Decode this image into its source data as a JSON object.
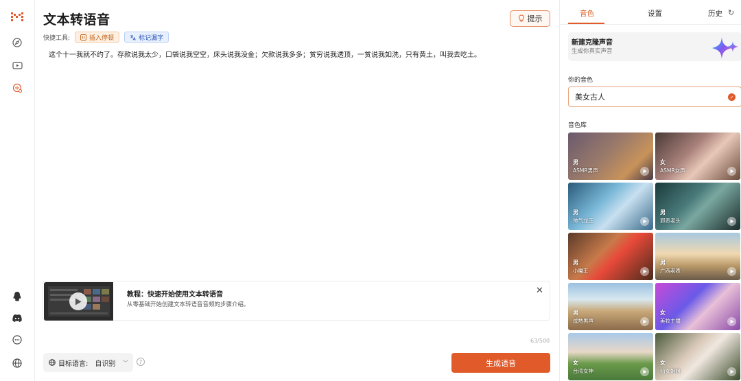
{
  "main": {
    "title": "文本转语音",
    "hint_label": "提示",
    "quick_tools_label": "快捷工具:",
    "insert_pause_label": "插入停顿",
    "mark_polyphone_label": "标记漏字",
    "body_text": "这个十一我就不约了。存款说我太少，口袋说我空空，床头说我没金；欠款说我多多；贫穷说我透顶，一贫说我如洗，只有黄土，叫我去吃土。",
    "char_count": "63/500",
    "target_lang_label": "目标语言:",
    "target_lang_value": "自识别",
    "generate_label": "生成语音"
  },
  "tutorial": {
    "title": "教程：快速开始使用文本转语音",
    "desc": "从零基础开始创建文本转语音音频的步骤介绍。"
  },
  "panel": {
    "tabs": [
      "音色",
      "设置",
      "历史"
    ],
    "clone_title": "新建克隆声音",
    "clone_sub": "生成你真实声音",
    "your_voice_label": "你的音色",
    "selected_voice": "美女古人",
    "library_label": "音色库",
    "voices": [
      {
        "gender": "男",
        "name": "ASMR男声"
      },
      {
        "gender": "女",
        "name": "ASMR女声"
      },
      {
        "gender": "男",
        "name": "帅气龙王"
      },
      {
        "gender": "男",
        "name": "邪恶老头"
      },
      {
        "gender": "男",
        "name": "小魔王"
      },
      {
        "gender": "男",
        "name": "广西老表"
      },
      {
        "gender": "男",
        "name": "成熟男声"
      },
      {
        "gender": "女",
        "name": "美妆主播"
      },
      {
        "gender": "女",
        "name": "台湾女神"
      },
      {
        "gender": "女",
        "name": "仙女姐姐"
      }
    ]
  },
  "colors": {
    "accent": "#e05a2a",
    "rail_icon": "#555555"
  }
}
